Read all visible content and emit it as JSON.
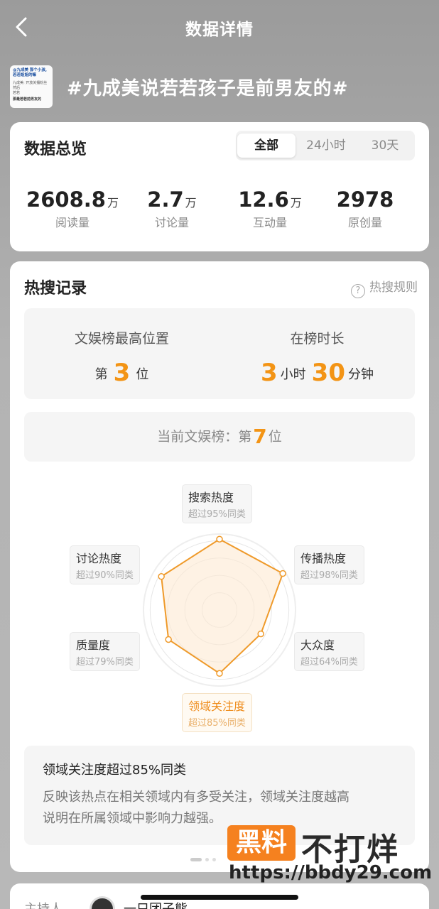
{
  "header": {
    "title": "数据详情"
  },
  "topic": {
    "title": "#九成美说若若孩子是前男友的#",
    "thumb_lines": [
      "@九成美 那个小孩,",
      "若若姐姐的嘛",
      "九成美: 开放关播粉丝 然后",
      "若若",
      "那最若若前男友的"
    ]
  },
  "overview": {
    "title": "数据总览",
    "tabs": [
      "全部",
      "24小时",
      "30天"
    ],
    "active_tab": "全部",
    "stats": [
      {
        "value": "2608.8",
        "unit": "万",
        "label": "阅读量"
      },
      {
        "value": "2.7",
        "unit": "万",
        "label": "讨论量"
      },
      {
        "value": "12.6",
        "unit": "万",
        "label": "互动量"
      },
      {
        "value": "2978",
        "unit": "",
        "label": "原创量"
      }
    ]
  },
  "hotsearch": {
    "title": "热搜记录",
    "rule_label": "热搜规则",
    "rule_icon": "question-circle-icon",
    "peak": {
      "title": "文娱榜最高位置",
      "prefix": "第",
      "value": "3",
      "suffix": "位"
    },
    "duration": {
      "title": "在榜时长",
      "hours": "3",
      "hours_unit": "小时",
      "minutes": "30",
      "minutes_unit": "分钟"
    },
    "current": {
      "prefix": "当前文娱榜：第",
      "value": "7",
      "suffix": "位"
    },
    "accent_color": "#f39415"
  },
  "radar": {
    "dimensions": [
      {
        "name": "搜索热度",
        "sub": "超过95%同类",
        "value": 95
      },
      {
        "name": "传播热度",
        "sub": "超过98%同类",
        "value": 98
      },
      {
        "name": "大众度",
        "sub": "超过64%同类",
        "value": 64
      },
      {
        "name": "领域关注度",
        "sub": "超过85%同类",
        "value": 85
      },
      {
        "name": "质量度",
        "sub": "超过79%同类",
        "value": 79
      },
      {
        "name": "讨论热度",
        "sub": "超过90%同类",
        "value": 90
      }
    ],
    "selected": "领域关注度",
    "line_color": "#ef9a2a",
    "fill_color": "#fde9d2"
  },
  "description": {
    "title": "领域关注度超过85%同类",
    "body_line1": "反映该热点在相关领域内有多受关注，领域关注度越高",
    "body_line2": "说明在所属领域中影响力越强。"
  },
  "host": {
    "label": "主持人",
    "name": "一只团子熊"
  },
  "watermark": {
    "badge": "黑料",
    "text": "不打烊",
    "url": "https://bbdy29.com"
  }
}
